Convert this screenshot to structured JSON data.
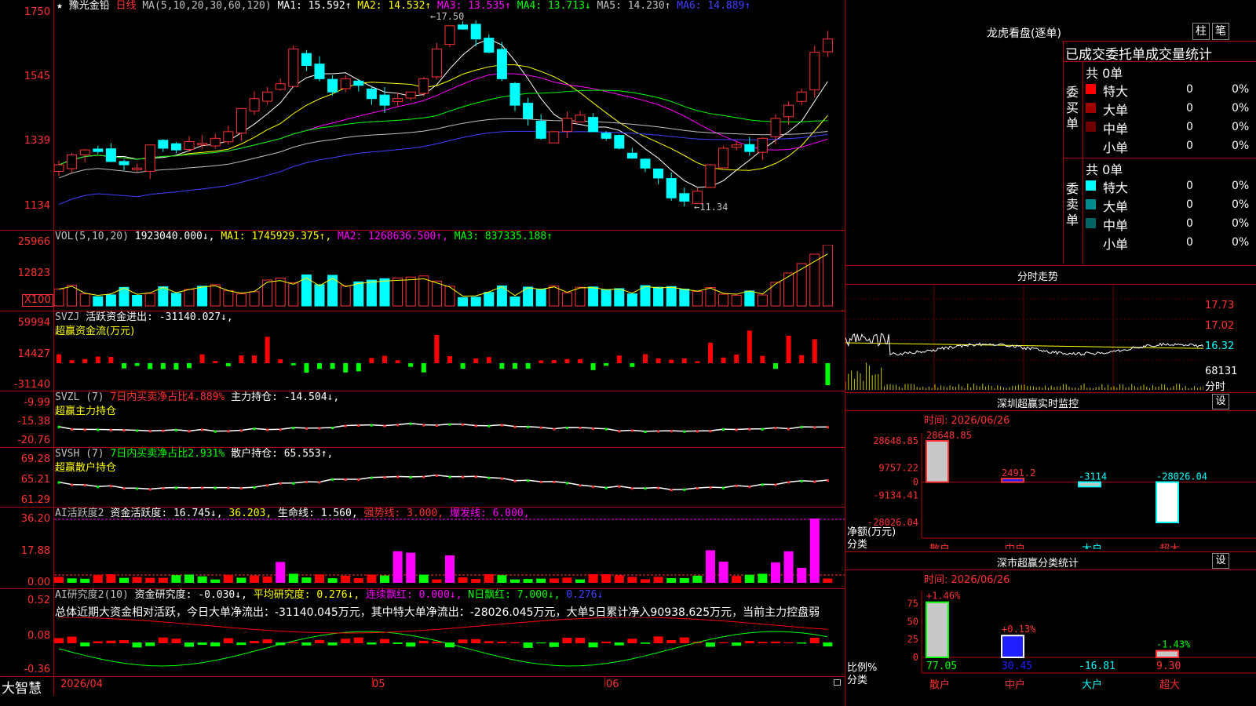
{
  "main": {
    "star": "★",
    "stock_name": "豫光金铅",
    "period": "日线",
    "ma_legend": "MA(5,10,20,30,60,120)",
    "ma": [
      {
        "label": "MA1: 15.592↑",
        "color": "#ffffff"
      },
      {
        "label": "MA2: 14.532↑",
        "color": "#ffff00"
      },
      {
        "label": "MA3: 13.535↑",
        "color": "#ff00ff"
      },
      {
        "label": "MA4: 13.713↓",
        "color": "#00ff00"
      },
      {
        "label": "MA5: 14.230↑",
        "color": "#c0c0c0"
      },
      {
        "label": "MA6: 14.889↑",
        "color": "#4040ff"
      }
    ],
    "yticks": [
      "1750",
      "1545",
      "1339",
      "1134"
    ],
    "high_mark": "←17.50",
    "low_mark": "←11.34"
  },
  "vol": {
    "legend_name": "VOL(5,10,20)",
    "value": "1923040.000↓,",
    "ma1": "MA1: 1745929.375↑,",
    "ma2": "MA2: 1268636.500↑,",
    "ma3": "MA3: 837335.188↑",
    "yticks": [
      "25966",
      "12823"
    ],
    "unit": "X100"
  },
  "svzj": {
    "legend_name": "SVZJ",
    "value": "活跃资金进出: -31140.027↓,",
    "subtitle": "超赢资金流(万元)",
    "yticks": [
      "59994",
      "14427",
      "-31140"
    ]
  },
  "svzl": {
    "legend_name": "SVZL (7)",
    "pct": "7日内买卖净占比4.889%",
    "hold": "主力持仓: -14.504↓,",
    "subtitle": "超赢主力持仓",
    "yticks": [
      "-9.99",
      "-15.38",
      "-20.76"
    ]
  },
  "svsh": {
    "legend_name": "SVSH (7)",
    "pct": "7日内买卖净占比2.931%",
    "hold": "散户持仓: 65.553↑,",
    "subtitle": "超赢散户持仓",
    "yticks": [
      "69.28",
      "65.21",
      "61.29"
    ]
  },
  "ai2": {
    "legend_name": "AI活跃度2",
    "a": "资金活跃度: 16.745↓,",
    "b": "36.203,",
    "c": "生命线: 1.560,",
    "d": "强势线: 3.000,",
    "e": "爆发线: 6.000,",
    "yticks": [
      "36.20",
      "17.88",
      "0.00"
    ]
  },
  "ai_research": {
    "legend_name": "AI研究度2(10)",
    "a": "资金研究度: -0.030↓,",
    "b": "平均研究度: 0.276↓,",
    "c": "连续飘红: 0.000↓,",
    "d": "N日飘红: 7.000↓,",
    "e": "0.276↓",
    "summary": "总体近期大资金相对活跃，今日大单净流出：-31140.045万元，其中特大单净流出：-28026.045万元，大单5日累计净入90938.625万元，当前主力控盘弱",
    "yticks": [
      "0.52",
      "0.08",
      "-0.36"
    ]
  },
  "footer": {
    "brand": "大智慧",
    "dates": [
      "2026/04",
      "05",
      "06"
    ]
  },
  "longhu": {
    "title": "龙虎看盘(逐单)",
    "btn1": "柱",
    "btn2": "笔",
    "header": "已成交委托单成交量统计",
    "buy_label": "委买单",
    "sell_label": "委卖单",
    "buy_total": "共 0单",
    "sell_total": "共 0单",
    "rows": [
      {
        "name": "特大",
        "count": "0",
        "pct": "0%"
      },
      {
        "name": "大单",
        "count": "0",
        "pct": "0%"
      },
      {
        "name": "中单",
        "count": "0",
        "pct": "0%"
      },
      {
        "name": "小单",
        "count": "0",
        "pct": "0%"
      }
    ],
    "buy_colors": [
      "#ff0000",
      "#a00000",
      "#700000",
      ""
    ],
    "sell_colors": [
      "#00ffff",
      "#008c8c",
      "#006464",
      ""
    ]
  },
  "fenshi": {
    "title": "分时走势",
    "yticks": [
      "17.73",
      "17.02",
      "16.32",
      "68131"
    ],
    "label": "分时"
  },
  "sz_monitor": {
    "title": "深圳超赢实时监控",
    "set": "设",
    "time": "时间: 2026/06/26",
    "yticks": [
      "28648.85",
      "9757.22",
      "0",
      "-9134.41",
      "-28026.04"
    ],
    "ylabel1": "净额(万元)",
    "ylabel2": "分类",
    "cats": [
      "散户",
      "中户",
      "大户",
      "超大"
    ],
    "values": [
      28648.85,
      2491.2,
      -3114,
      -28026.04
    ],
    "value_labels": [
      "28648.85",
      "2491.2",
      "-3114",
      "-28026.04"
    ]
  },
  "sz_class": {
    "title": "深市超赢分类统计",
    "set": "设",
    "time": "时间: 2026/06/26",
    "yticks": [
      "75",
      "50",
      "25",
      "0"
    ],
    "ylabel1": "比例%",
    "ylabel2": "分类",
    "cats": [
      "散户",
      "中户",
      "大户",
      "超大"
    ],
    "values": [
      77.05,
      30.45,
      -16.81,
      9.3
    ],
    "value_labels": [
      "77.05",
      "30.45",
      "-16.81",
      "9.30"
    ],
    "change_labels": [
      "+1.46%",
      "+0.13%",
      "",
      "-1.43%"
    ]
  }
}
